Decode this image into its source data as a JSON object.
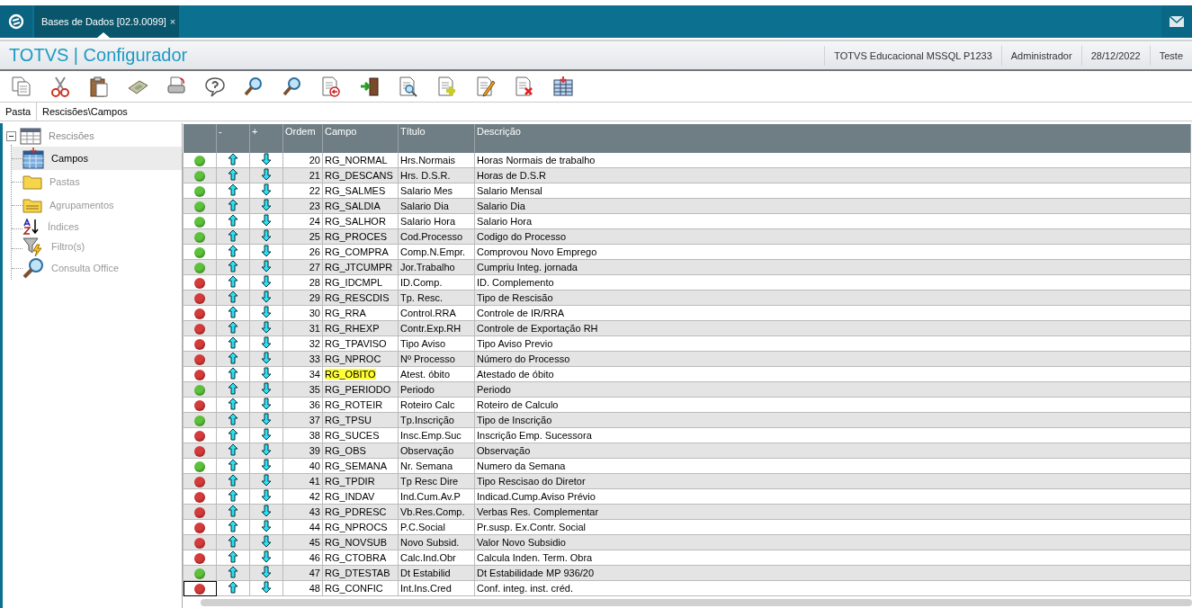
{
  "tab_bar": {
    "tabs": [
      {
        "label": "Bases de Dados [02.9.0099]",
        "selected": true,
        "close": "×"
      }
    ]
  },
  "header": {
    "app_title": "TOTVS | Configurador",
    "info": [
      "TOTVS Educacional MSSQL P1233",
      "Administrador",
      "28/12/2022",
      "Teste"
    ]
  },
  "folder_bar": {
    "label": "Pasta",
    "path": "Rescisões\\Campos"
  },
  "tree": {
    "label": "Rescisões",
    "expanded": true,
    "children": [
      {
        "label": "Campos",
        "kind": "table",
        "selected": true
      },
      {
        "label": "Pastas",
        "kind": "folder",
        "selected": false
      },
      {
        "label": "Agrupamentos",
        "kind": "group",
        "selected": false
      },
      {
        "label": "Índices",
        "kind": "index",
        "selected": false
      },
      {
        "label": "Filtro(s)",
        "kind": "filter",
        "selected": false
      },
      {
        "label": "Consulta Office",
        "kind": "search",
        "selected": false
      }
    ]
  },
  "grid": {
    "columns": [
      "-",
      "+",
      "Ordem",
      "Campo",
      "Título",
      "Descrição"
    ],
    "rows": [
      {
        "color": "#5cc23a",
        "order": "20",
        "field": "RG_NORMAL",
        "title": "Hrs.Normais",
        "description": "Horas Normais de trabalho",
        "highlighted": false,
        "focused": false
      },
      {
        "color": "#5cc23a",
        "order": "21",
        "field": "RG_DESCANS",
        "title": "Hrs. D.S.R.",
        "description": "Horas de D.S.R",
        "highlighted": false,
        "focused": false
      },
      {
        "color": "#5cc23a",
        "order": "22",
        "field": "RG_SALMES",
        "title": "Salario Mes",
        "description": "Salario Mensal",
        "highlighted": false,
        "focused": false
      },
      {
        "color": "#5cc23a",
        "order": "23",
        "field": "RG_SALDIA",
        "title": "Salario Dia",
        "description": "Salario Dia",
        "highlighted": false,
        "focused": false
      },
      {
        "color": "#5cc23a",
        "order": "24",
        "field": "RG_SALHOR",
        "title": "Salario Hora",
        "description": "Salario Hora",
        "highlighted": false,
        "focused": false
      },
      {
        "color": "#5cc23a",
        "order": "25",
        "field": "RG_PROCES",
        "title": "Cod.Processo",
        "description": "Codigo do Processo",
        "highlighted": false,
        "focused": false
      },
      {
        "color": "#5cc23a",
        "order": "26",
        "field": "RG_COMPRA",
        "title": "Comp.N.Empr.",
        "description": "Comprovou Novo Emprego",
        "highlighted": false,
        "focused": false
      },
      {
        "color": "#5cc23a",
        "order": "27",
        "field": "RG_JTCUMPR",
        "title": "Jor.Trabalho",
        "description": "Cumpriu Integ. jornada",
        "highlighted": false,
        "focused": false
      },
      {
        "color": "#d63a3a",
        "order": "28",
        "field": "RG_IDCMPL",
        "title": "ID.Comp.",
        "description": "ID. Complemento",
        "highlighted": false,
        "focused": false
      },
      {
        "color": "#d63a3a",
        "order": "29",
        "field": "RG_RESCDIS",
        "title": "Tp. Resc.",
        "description": "Tipo de Rescisão",
        "highlighted": false,
        "focused": false
      },
      {
        "color": "#d63a3a",
        "order": "30",
        "field": "RG_RRA",
        "title": "Control.RRA",
        "description": "Controle de IR/RRA",
        "highlighted": false,
        "focused": false
      },
      {
        "color": "#d63a3a",
        "order": "31",
        "field": "RG_RHEXP",
        "title": "Contr.Exp.RH",
        "description": "Controle de Exportação RH",
        "highlighted": false,
        "focused": false
      },
      {
        "color": "#d63a3a",
        "order": "32",
        "field": "RG_TPAVISO",
        "title": "Tipo Aviso",
        "description": "Tipo Aviso Previo",
        "highlighted": false,
        "focused": false
      },
      {
        "color": "#d63a3a",
        "order": "33",
        "field": "RG_NPROC",
        "title": "Nº Processo",
        "description": "Número do Processo",
        "highlighted": false,
        "focused": false
      },
      {
        "color": "#d63a3a",
        "order": "34",
        "field": "RG_OBITO",
        "title": "Atest. óbito",
        "description": "Atestado de óbito",
        "highlighted": true,
        "focused": false
      },
      {
        "color": "#5cc23a",
        "order": "35",
        "field": "RG_PERIODO",
        "title": "Periodo",
        "description": "Periodo",
        "highlighted": false,
        "focused": false
      },
      {
        "color": "#d63a3a",
        "order": "36",
        "field": "RG_ROTEIR",
        "title": "Roteiro Calc",
        "description": "Roteiro de Calculo",
        "highlighted": false,
        "focused": false
      },
      {
        "color": "#5cc23a",
        "order": "37",
        "field": "RG_TPSU",
        "title": "Tp.Inscrição",
        "description": "Tipo de Inscrição",
        "highlighted": false,
        "focused": false
      },
      {
        "color": "#d63a3a",
        "order": "38",
        "field": "RG_SUCES",
        "title": "Insc.Emp.Suc",
        "description": "Inscrição Emp. Sucessora",
        "highlighted": false,
        "focused": false
      },
      {
        "color": "#d63a3a",
        "order": "39",
        "field": "RG_OBS",
        "title": "Observação",
        "description": "Observação",
        "highlighted": false,
        "focused": false
      },
      {
        "color": "#5cc23a",
        "order": "40",
        "field": "RG_SEMANA",
        "title": "Nr. Semana",
        "description": "Numero da Semana",
        "highlighted": false,
        "focused": false
      },
      {
        "color": "#d63a3a",
        "order": "41",
        "field": "RG_TPDIR",
        "title": "Tp Resc Dire",
        "description": "Tipo Rescisao do Diretor",
        "highlighted": false,
        "focused": false
      },
      {
        "color": "#d63a3a",
        "order": "42",
        "field": "RG_INDAV",
        "title": "Ind.Cum.Av.P",
        "description": "Indicad.Cump.Aviso Prévio",
        "highlighted": false,
        "focused": false
      },
      {
        "color": "#d63a3a",
        "order": "43",
        "field": "RG_PDRESC",
        "title": "Vb.Res.Comp.",
        "description": "Verbas Res. Complementar",
        "highlighted": false,
        "focused": false
      },
      {
        "color": "#d63a3a",
        "order": "44",
        "field": "RG_NPROCS",
        "title": "P.C.Social",
        "description": "Pr.susp. Ex.Contr. Social",
        "highlighted": false,
        "focused": false
      },
      {
        "color": "#d63a3a",
        "order": "45",
        "field": "RG_NOVSUB",
        "title": "Novo Subsid.",
        "description": "Valor Novo Subsidio",
        "highlighted": false,
        "focused": false
      },
      {
        "color": "#d63a3a",
        "order": "46",
        "field": "RG_CTOBRA",
        "title": "Calc.Ind.Obr",
        "description": "Calcula Inden. Term. Obra",
        "highlighted": false,
        "focused": false
      },
      {
        "color": "#5cc23a",
        "order": "47",
        "field": "RG_DTESTAB",
        "title": "Dt Estabilid",
        "description": "Dt Estabilidade MP 936/20",
        "highlighted": false,
        "focused": false
      },
      {
        "color": "#d63a3a",
        "order": "48",
        "field": "RG_CONFIC",
        "title": "Int.Ins.Cred",
        "description": "Conf. integ. inst. créd.",
        "highlighted": false,
        "focused": true
      }
    ]
  }
}
